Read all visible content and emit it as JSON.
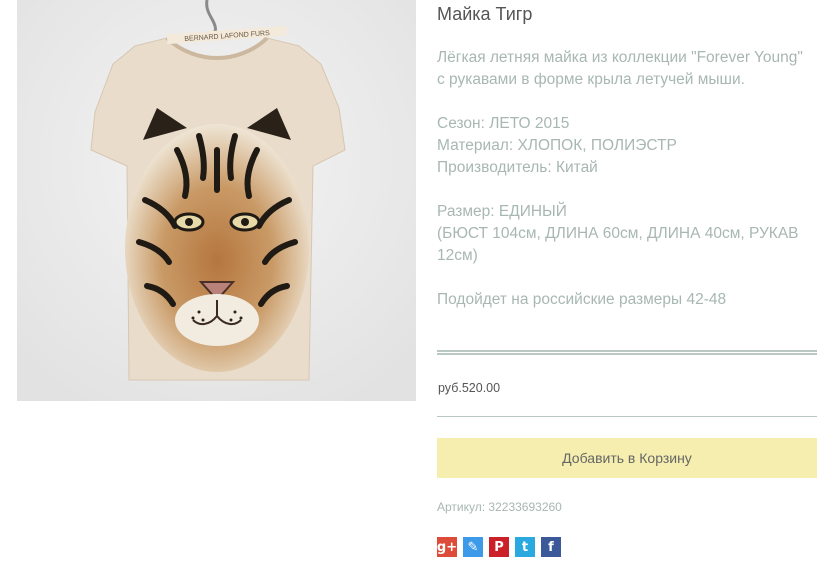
{
  "product": {
    "image_alt": "Майка Тигр",
    "label_text": "BERNARD LAFOND FURS",
    "title": "Майка Тигр",
    "description_lines": [
      "Лёгкая летняя майка из коллекции \"Forever Young\" с рукавами в форме крыла летучей мыши."
    ],
    "season": "Сезон: ЛЕТО 2015",
    "material": "Материал: ХЛОПОК, ПОЛИЭСТР",
    "maker": "Производитель: Китай",
    "size": "Размер: ЕДИНЫЙ",
    "measurements": "(БЮСТ 104см, ДЛИНА 60см, ДЛИНА 40см, РУКАВ 12см)",
    "fits": "Подойдет на российские размеры 42-48",
    "price": "руб.520.00",
    "add_to_cart": "Добавить в Корзину",
    "sku_label": "Артикул:",
    "sku_value": "32233693260"
  },
  "share": [
    {
      "name": "google-plus",
      "glyph": "g+",
      "color": "#dd4b39"
    },
    {
      "name": "livejournal",
      "glyph": "✎",
      "color": "#3d9ae8"
    },
    {
      "name": "pinterest",
      "glyph": "P",
      "color": "#cb2027"
    },
    {
      "name": "twitter",
      "glyph": "t",
      "color": "#2aa9e0"
    },
    {
      "name": "facebook",
      "glyph": "f",
      "color": "#3b5998"
    }
  ],
  "colors": {
    "accent_text": "#a8b7b1",
    "button_bg": "#f5eeaf",
    "rule": "#b9c8c2"
  }
}
